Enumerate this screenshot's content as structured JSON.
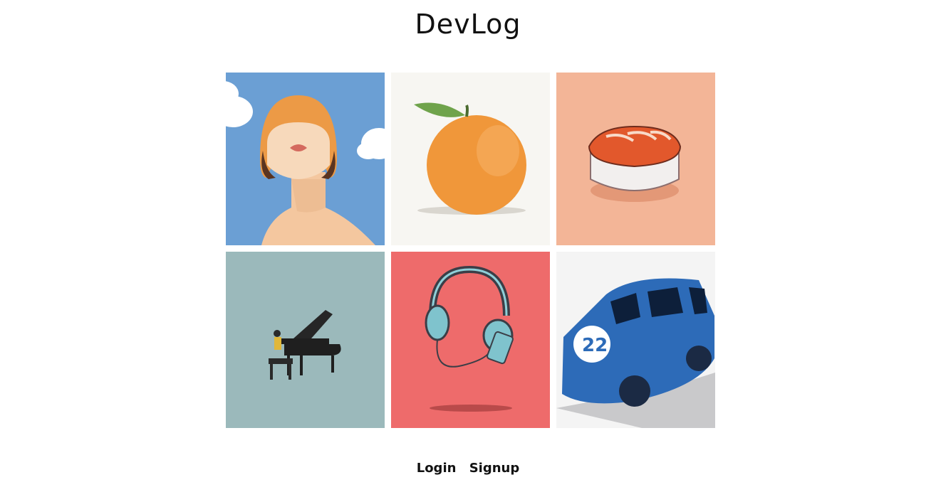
{
  "header": {
    "title": "DevLog"
  },
  "gallery": {
    "tiles": [
      {
        "icon": "woman-portrait-illustration",
        "bg": "#6b9fd4"
      },
      {
        "icon": "orange-fruit-illustration",
        "bg": "#f7f6f2"
      },
      {
        "icon": "sushi-illustration",
        "bg": "#f3b597"
      },
      {
        "icon": "grand-piano-illustration",
        "bg": "#9bb9bb"
      },
      {
        "icon": "headphones-illustration",
        "bg": "#ee6b6b"
      },
      {
        "icon": "blue-car-illustration",
        "bg": "#f4f4f4"
      }
    ]
  },
  "footer": {
    "login_label": "Login",
    "signup_label": "Signup"
  }
}
